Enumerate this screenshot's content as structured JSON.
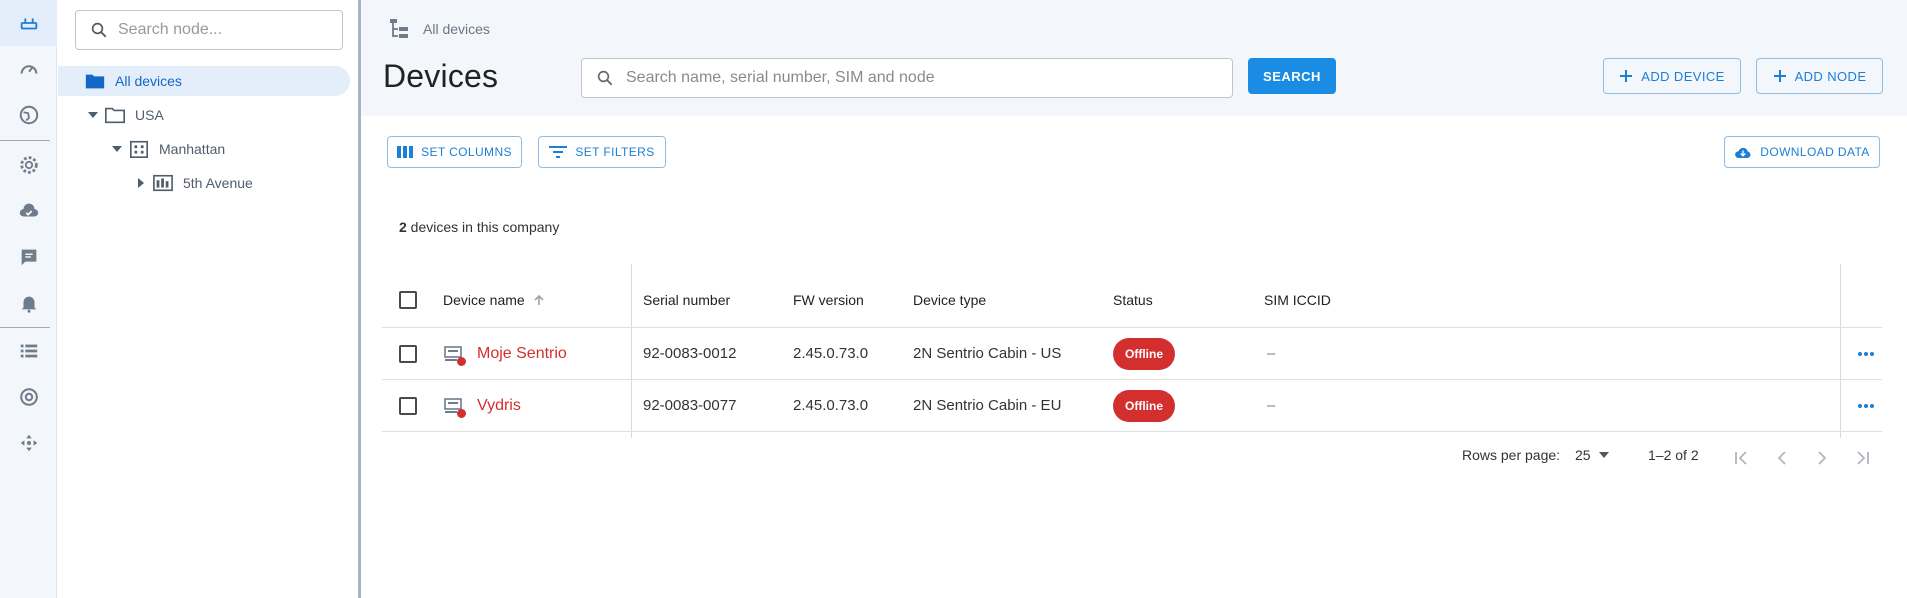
{
  "tree": {
    "search_placeholder": "Search node...",
    "items": [
      {
        "label": "All devices"
      },
      {
        "label": "USA"
      },
      {
        "label": "Manhattan"
      },
      {
        "label": "5th Avenue"
      }
    ]
  },
  "header": {
    "breadcrumb": "All devices",
    "title": "Devices",
    "search_placeholder": "Search name, serial number, SIM and node",
    "search_button": "SEARCH",
    "add_device": "ADD DEVICE",
    "add_node": "ADD NODE"
  },
  "toolbar": {
    "set_columns": "SET COLUMNS",
    "set_filters": "SET FILTERS",
    "download": "DOWNLOAD DATA"
  },
  "summary": {
    "count": "2",
    "text": " devices in this company"
  },
  "table": {
    "columns": [
      "Device name",
      "Serial number",
      "FW version",
      "Device type",
      "Status",
      "SIM ICCID"
    ],
    "rows": [
      {
        "name": "Moje Sentrio",
        "serial": "92-0083-0012",
        "fw": "2.45.0.73.0",
        "type": "2N Sentrio Cabin - US",
        "status": "Offline",
        "sim": "–"
      },
      {
        "name": "Vydris",
        "serial": "92-0083-0077",
        "fw": "2.45.0.73.0",
        "type": "2N Sentrio Cabin - EU",
        "status": "Offline",
        "sim": "–"
      }
    ]
  },
  "pagination": {
    "rows_label": "Rows per page:",
    "rows_value": "25",
    "range": "1–2 of 2"
  },
  "colors": {
    "accent": "#1b8ce3",
    "offline": "#d32f2f",
    "header_bg": "#f3f6fa"
  }
}
